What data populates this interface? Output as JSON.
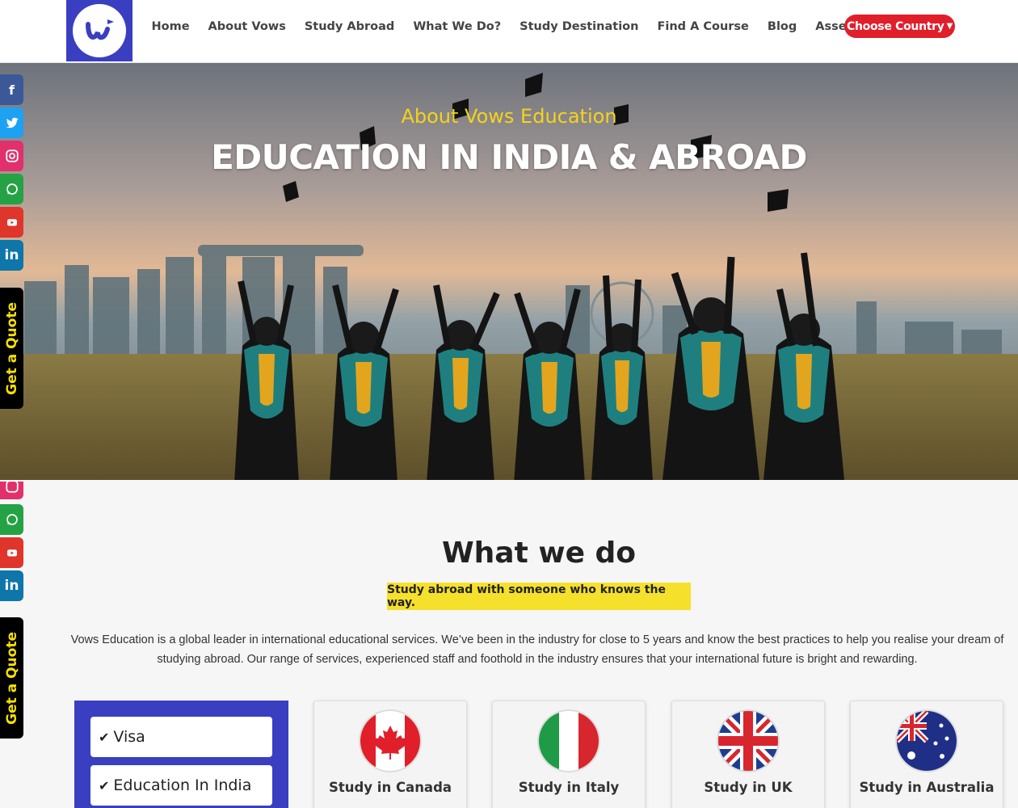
{
  "header": {
    "nav": [
      "Home",
      "About Vows",
      "Study Abroad",
      "What We Do?",
      "Study Destination",
      "Find A Course",
      "Blog",
      "Assessment Form"
    ],
    "choose_country": "Choose Country"
  },
  "hero": {
    "subtitle": "About Vows Education",
    "title": "EDUCATION IN INDIA & ABROAD"
  },
  "sidebar": {
    "social": [
      {
        "name": "facebook",
        "color": "#3b5998"
      },
      {
        "name": "twitter",
        "color": "#1da1f2"
      },
      {
        "name": "instagram",
        "color": "#e1306c"
      },
      {
        "name": "whatsapp",
        "color": "#25a244"
      },
      {
        "name": "youtube",
        "color": "#e0352b"
      },
      {
        "name": "linkedin",
        "color": "#0e76a8"
      }
    ],
    "quote_label": "Get a Quote"
  },
  "what_we_do": {
    "title": "What we do",
    "tagline": "Study abroad with someone who knows the way.",
    "description": "Vows Education is a global leader in international educational services. We’ve been in the industry for close to 5 years and know the best practices to help you realise your dream of studying abroad. Our range of services, experienced staff and foothold in the industry ensures that your international future is bright and rewarding."
  },
  "services": [
    "Visa",
    "Education In India"
  ],
  "countries": [
    "Study in Canada",
    "Study in Italy",
    "Study in UK",
    "Study in Australia"
  ],
  "colors": {
    "brand_blue": "#3a3fc1",
    "accent_red": "#e01f2b",
    "accent_yellow": "#f5e12b",
    "hero_subtitle": "#f5d31a"
  }
}
